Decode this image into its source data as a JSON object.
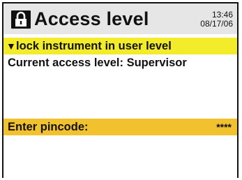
{
  "header": {
    "title": "Access level",
    "icon": "lock-icon",
    "time": "13:46",
    "date": "08/17/06",
    "background": "#e6e6e6"
  },
  "menu": {
    "lock_option": {
      "arrow": "▼",
      "label": "lock instrument in user level",
      "highlight": "#f3ec2a"
    },
    "current_level": {
      "label": "Current access level: Supervisor"
    },
    "pincode": {
      "label": "Enter pincode:",
      "value": "****",
      "highlight": "#f2c12e"
    }
  }
}
